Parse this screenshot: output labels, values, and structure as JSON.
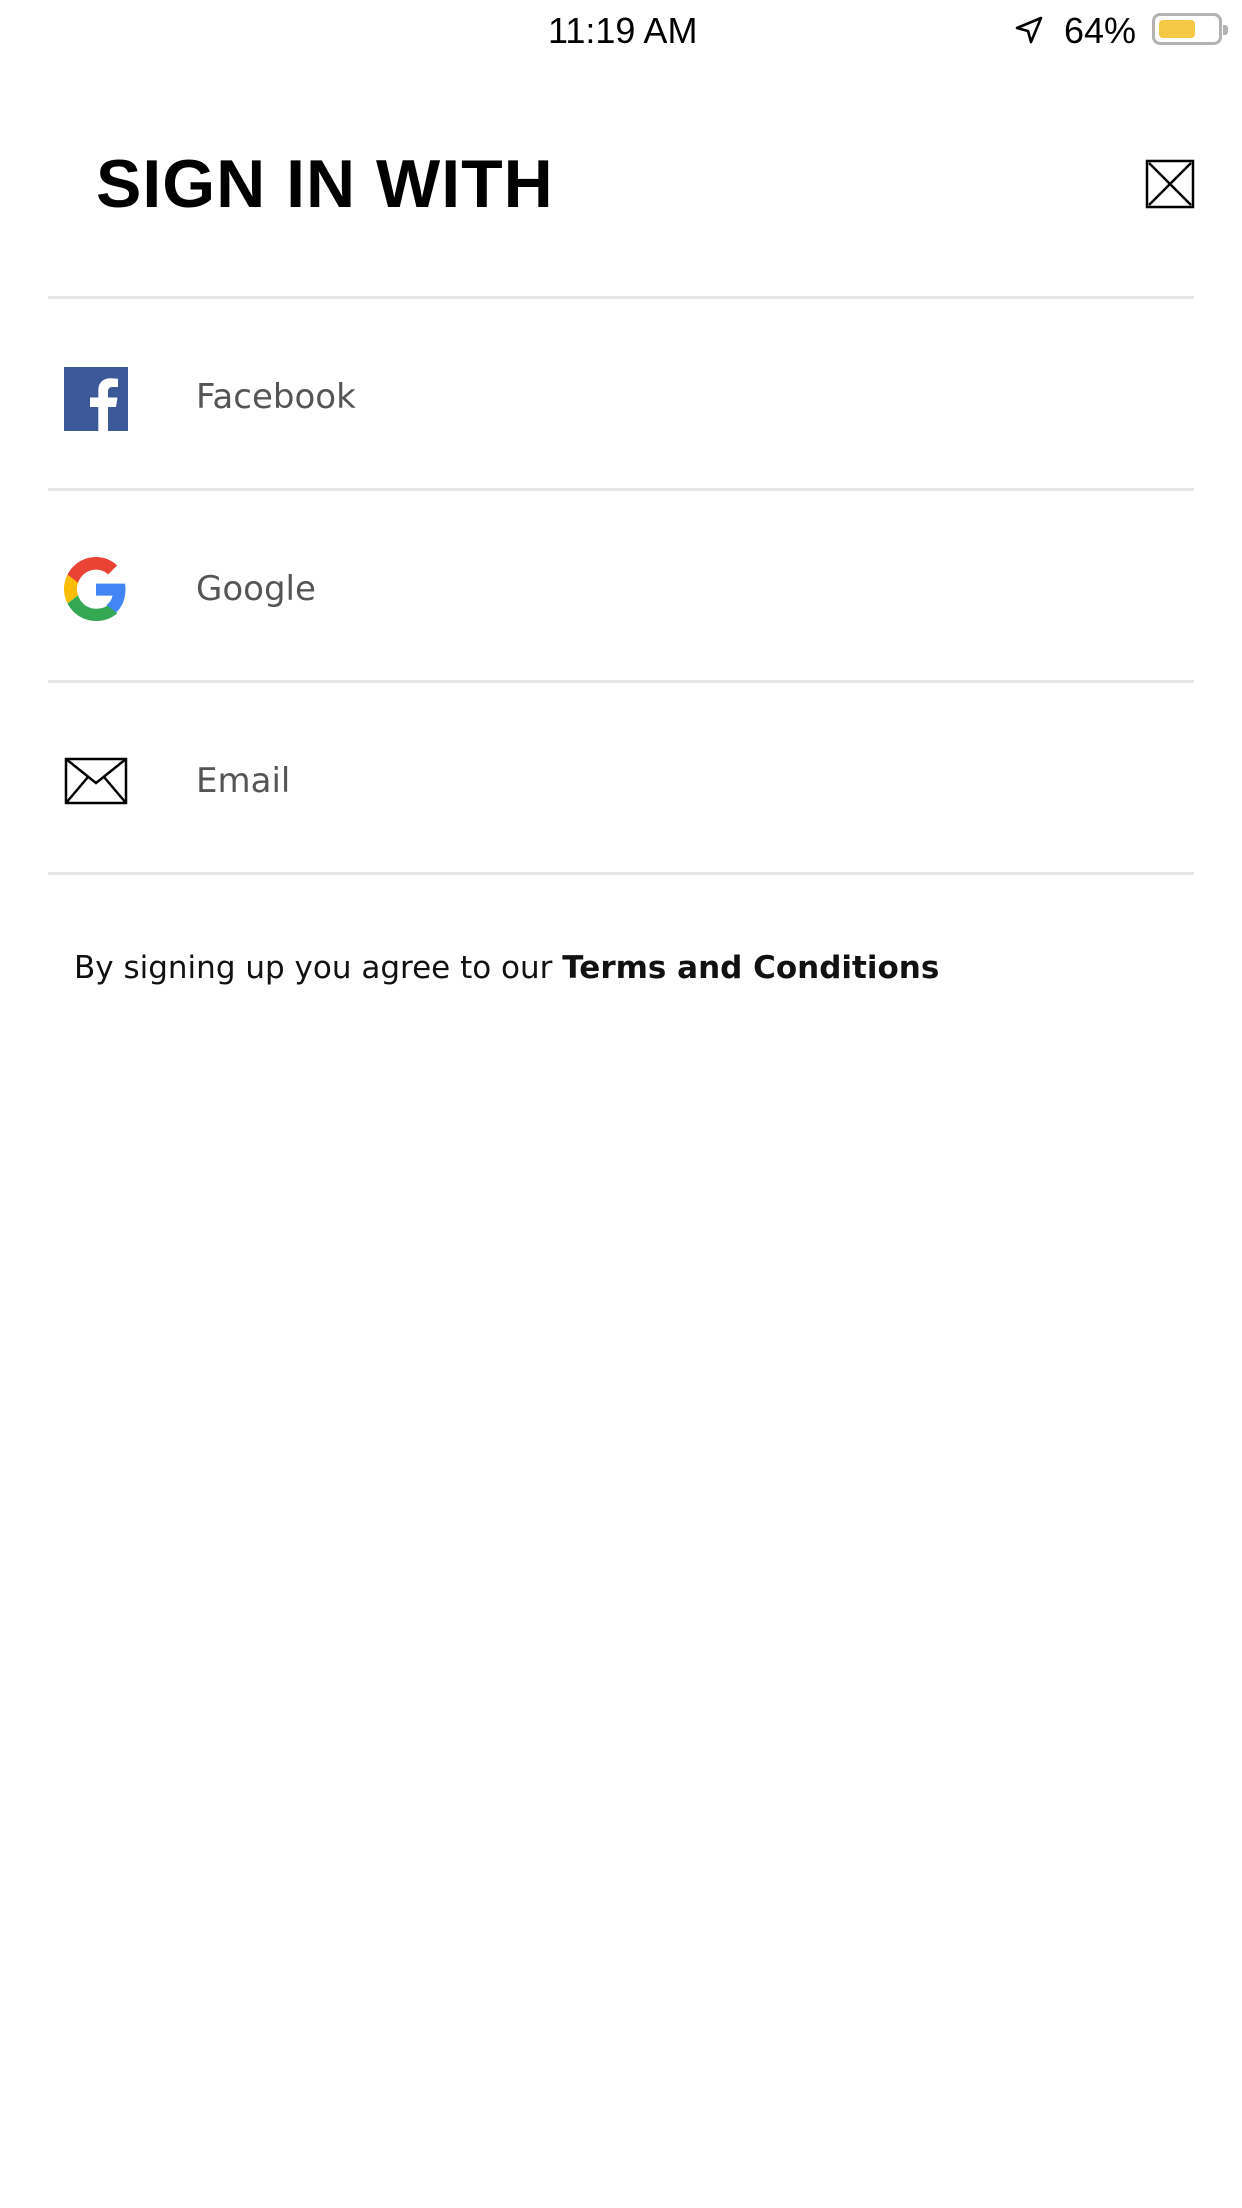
{
  "status_bar": {
    "time": "11:19 AM",
    "battery_percent": "64%",
    "battery_level": 0.64,
    "icons": [
      "location-arrow-icon",
      "battery-icon"
    ]
  },
  "header": {
    "title": "SIGN IN WITH",
    "close_icon": "close-icon"
  },
  "options": [
    {
      "label": "Facebook",
      "icon": "facebook-icon"
    },
    {
      "label": "Google",
      "icon": "google-icon"
    },
    {
      "label": "Email",
      "icon": "email-icon"
    }
  ],
  "footer": {
    "terms_prefix": "By signing up you agree to our ",
    "terms_link": "Terms and Conditions"
  },
  "colors": {
    "facebook": "#3b5998",
    "battery_fill": "#f5c945",
    "divider": "#e6e6e6",
    "label_text": "#555555"
  }
}
